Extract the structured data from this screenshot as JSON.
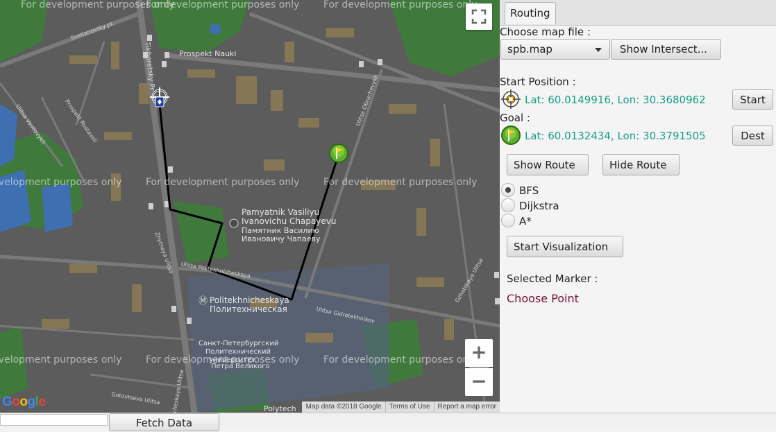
{
  "map": {
    "watermark": "For development purposes only",
    "streets": {
      "svetlanovsky": "Svetlanovsky pr.",
      "tikhoretsky": "Tikhoretsky Pr",
      "nauki": "Prospekt Nauki",
      "vavilovykh": "Ulitsa Vavilovykh",
      "rustaveli": "Prospekt Rustaveli",
      "obruchevykh": "Ulitsa Obruchevykh",
      "grazhdanskiy": "Grazhdanskiy",
      "politekh_st": "Ulitsa Politekhnicheskaya",
      "gidrotekh": "Ulitsa Gidrotekhnikov",
      "zhyloy": "Zhytnaya Ulitsa",
      "kurchatova": "Ulitsa Kurchatova",
      "khlopina": "Ulitsa Khlopina",
      "gzhatskaya": "Gzhatskaya Ulitsa",
      "novorossiyskaya": "Novorossiyskaya Ulitsa",
      "gotovtseva": "Gotovtseva Ulitsa",
      "cheskaya": "cheskaya Ulitsa",
      "shaumyana": "Shaumyana Ulitsa"
    },
    "poi": {
      "chapayev_line1": "Pamyatnik Vasiliyu",
      "chapayev_line2": "Ivanovichu Chapayevu",
      "chapayev_ru1": "Памятник Василию",
      "chapayev_ru2": "Ивановичу Чапаеву",
      "metro_en": "Politekhnicheskaya",
      "metro_ru": "Политехническая",
      "uni_ru1": "Санкт-Петербургский",
      "uni_ru2": "Политехнический",
      "uni_ru3": "университет",
      "uni_ru4": "Петра Великого",
      "polytech": "Polytech"
    },
    "zoom_in": "+",
    "zoom_out": "−",
    "google": [
      "G",
      "o",
      "o",
      "g",
      "l",
      "e"
    ],
    "attribution": {
      "data": "Map data ©2018 Google",
      "terms": "Terms of Use",
      "report": "Report a map error"
    },
    "colors": {
      "background": "#5c5c5c",
      "route": "#000000",
      "park": "#3f7a3c",
      "building": "#8a7a55",
      "water": "#3e6fb0"
    }
  },
  "panel": {
    "tab_label": "Routing",
    "choose_map_label": "Choose map file :",
    "map_file_value": "spb.map",
    "show_intersections_label": "Show Intersect...",
    "start_position_label": "Start Position :",
    "start_coords": "Lat: 60.0149916, Lon: 30.3680962",
    "start_button": "Start",
    "goal_label": "Goal :",
    "goal_coords": "Lat: 60.0132434, Lon: 30.3791505",
    "dest_button": "Dest",
    "show_route": "Show Route",
    "hide_route": "Hide Route",
    "algorithms": [
      "BFS",
      "Dijkstra",
      "A*"
    ],
    "selected_algorithm": "BFS",
    "start_visualization": "Start Visualization",
    "selected_marker_label": "Selected Marker :",
    "choose_point": "Choose Point",
    "colors": {
      "coord_text": "#18a08a",
      "choose_point": "#7a1030"
    }
  },
  "bottom": {
    "fetch_data": "Fetch Data"
  }
}
